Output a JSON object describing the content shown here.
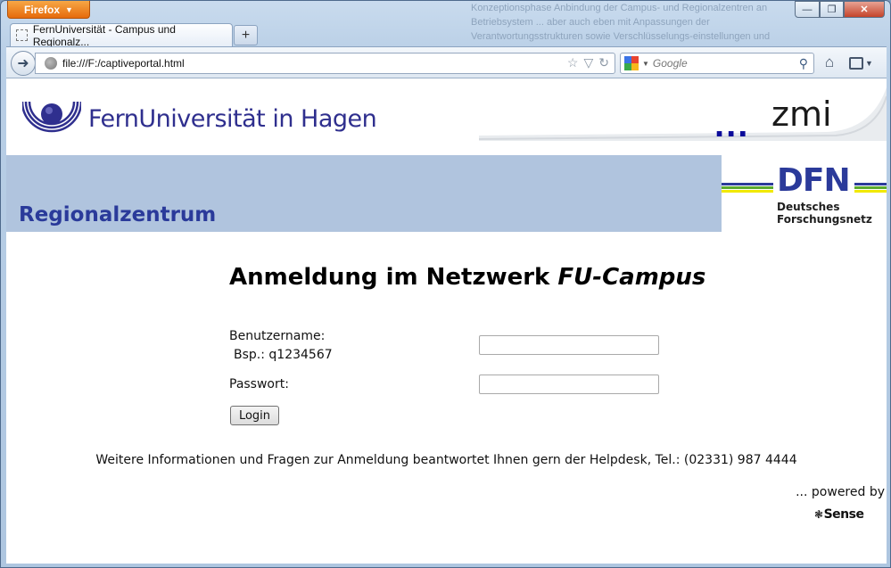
{
  "browser": {
    "app_button_label": "Firefox",
    "tab_title": "FernUniversität - Campus und Regionalz...",
    "new_tab_label": "+",
    "url": "file:///F:/captiveportal.html",
    "search_placeholder": "Google",
    "window_min": "—",
    "window_max": "❐",
    "window_close": "✕"
  },
  "background_text": "Konzeptionsphase Anbindung der Campus- und Regionalzentren an Betriebsystem ... aber auch eben mit Anpassungen der Verantwortungsstrukturen sowie Verschlüsselungs-einstellungen und nicht erforderlich",
  "page": {
    "logo_text": "FernUniversität in Hagen",
    "zmi_dots": "...",
    "zmi_text": "zmi",
    "banner_title": "Regionalzentrum",
    "dfn_logo": "DFN",
    "dfn_sub_line1": "Deutsches",
    "dfn_sub_line2": "Forschungsnetz",
    "form_title_prefix": "Anmeldung im Netzwerk ",
    "form_title_italic": "FU-Campus",
    "username_label": "Benutzername:",
    "username_hint": "Bsp.: q1234567",
    "username_value": "",
    "password_label": "Passwort:",
    "password_value": "",
    "login_button": "Login",
    "info_text": "Weitere Informationen und Fragen zur Anmeldung beantwortet Ihnen gern der Helpdesk, Tel.: (02331) 987 4444",
    "powered_by": "... powered by",
    "sense_logo": "Sense"
  },
  "colors": {
    "fu_blue": "#2f2f8e",
    "banner_bg": "#b0c4de",
    "dfn_blue": "#2b3a9a",
    "firefox_orange": "#e66b0c"
  }
}
